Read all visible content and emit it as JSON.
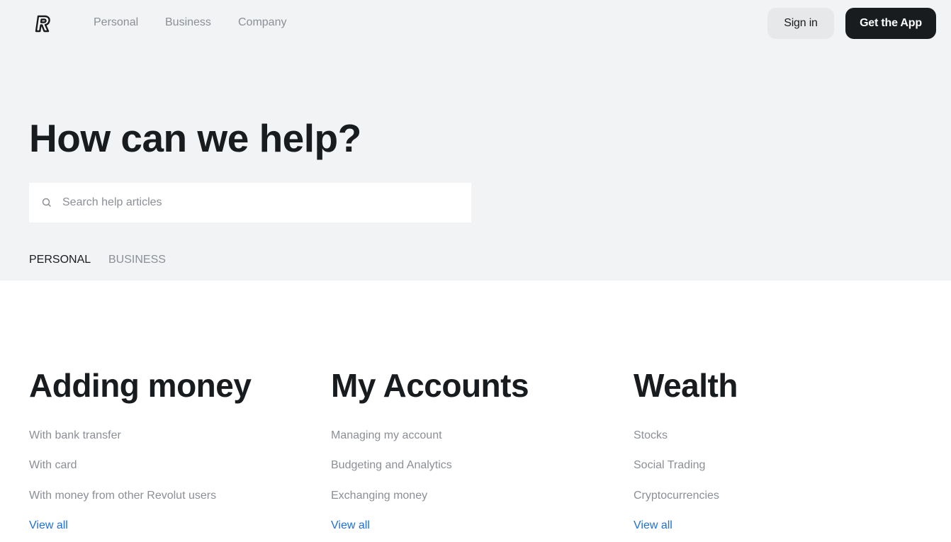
{
  "header": {
    "logo_icon": "revolut-r-logo",
    "nav": [
      {
        "label": "Personal"
      },
      {
        "label": "Business"
      },
      {
        "label": "Company"
      }
    ],
    "sign_in_label": "Sign in",
    "get_app_label": "Get the App"
  },
  "hero": {
    "title": "How can we help?",
    "search": {
      "icon": "search-icon",
      "placeholder": "Search help articles",
      "value": ""
    },
    "tabs": [
      {
        "label": "PERSONAL",
        "active": true
      },
      {
        "label": "BUSINESS",
        "active": false
      }
    ]
  },
  "categories": [
    {
      "title": "Adding money",
      "links": [
        "With bank transfer",
        "With card",
        "With money from other Revolut users"
      ],
      "view_all": "View all"
    },
    {
      "title": "My Accounts",
      "links": [
        "Managing my account",
        "Budgeting and Analytics",
        "Exchanging money"
      ],
      "view_all": "View all"
    },
    {
      "title": "Wealth",
      "links": [
        "Stocks",
        "Social Trading",
        "Cryptocurrencies"
      ],
      "view_all": "View all"
    }
  ],
  "colors": {
    "hero_bg": "#f2f3f5",
    "text_dark": "#191c1f",
    "text_muted": "#8b8f96",
    "link_blue": "#1e6fd9"
  }
}
